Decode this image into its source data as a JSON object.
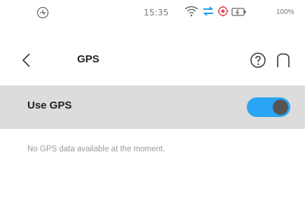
{
  "status_bar": {
    "time": "15:35",
    "battery_percent": "100%",
    "icons": [
      "app-status-icon",
      "wifi-icon",
      "data-transfer-icon",
      "location-icon",
      "battery-charging-icon"
    ]
  },
  "header": {
    "title": "GPS"
  },
  "setting": {
    "label": "Use GPS",
    "enabled": true,
    "accent_color": "#2aa4f4"
  },
  "info": {
    "message": "No GPS data available at the moment."
  }
}
